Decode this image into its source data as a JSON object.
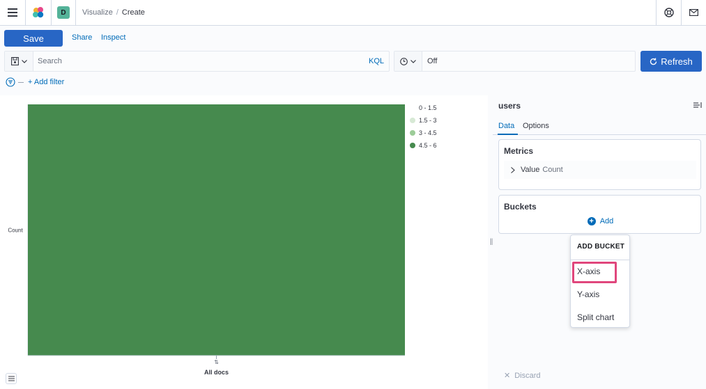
{
  "header": {
    "space_initial": "D",
    "breadcrumbs": [
      "Visualize",
      "Create"
    ]
  },
  "actions": {
    "save": "Save",
    "share": "Share",
    "inspect": "Inspect"
  },
  "query": {
    "placeholder": "Search",
    "language": "KQL"
  },
  "time": {
    "value": "Off",
    "refresh": "Refresh"
  },
  "filters": {
    "add_label": "+ Add filter"
  },
  "chart_data": {
    "type": "heatmap",
    "categories": [
      "All docs"
    ],
    "ylabel": "Count",
    "xlabel": "",
    "legend": [
      "0 - 1.5",
      "1.5 - 3",
      "3 - 4.5",
      "4.5 - 6"
    ],
    "legend_colors": [
      "#ffffff",
      "#d7e9d5",
      "#9ccc98",
      "#468a4e"
    ],
    "cells": [
      {
        "x": "All docs",
        "range": "4.5 - 6"
      }
    ],
    "cell_color": "#468a4e",
    "legend_placement": "right"
  },
  "sidebar": {
    "index_pattern": "users",
    "tabs": [
      "Data",
      "Options"
    ],
    "metrics_title": "Metrics",
    "metric_label": "Value",
    "metric_value": "Count",
    "buckets_title": "Buckets",
    "add_label": "Add",
    "discard_label": "Discard"
  },
  "add_bucket_menu": {
    "title": "ADD BUCKET",
    "items": [
      "X-axis",
      "Y-axis",
      "Split chart"
    ],
    "highlight_color": "#e0467c"
  }
}
